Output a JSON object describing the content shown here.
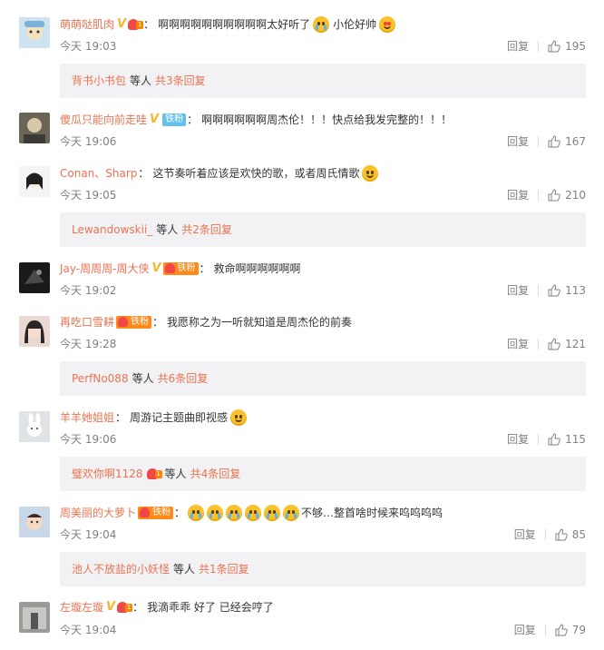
{
  "comments": [
    {
      "name": "萌萌哒肌肉",
      "verified": true,
      "fan_badge": "simple",
      "text": "啊啊啊啊啊啊啊啊啊啊太好听了",
      "tail": "小伦好帅",
      "emojis": [
        "cry-emoji",
        "love-emoji"
      ],
      "time": "今天 19:03",
      "reply_label": "回复",
      "likes": "195",
      "sub": {
        "name": "背书小书包",
        "mid": "等人",
        "count": "共3条回复"
      }
    },
    {
      "name": "傻瓜只能向前走哇",
      "verified": true,
      "fan_badge": "tiefen-blue",
      "fan_label": "铁粉",
      "text": "啊啊啊啊啊啊周杰伦！！！快点给我发完整的！！！",
      "tail": "",
      "emojis": [],
      "time": "今天 19:06",
      "reply_label": "回复",
      "likes": "167"
    },
    {
      "name": "Conan、Sharp",
      "verified": false,
      "fan_badge": "",
      "text": "这节奏听着应该是欢快的歌，或者周氏情歌",
      "tail": "",
      "emojis": [
        "smile-emoji"
      ],
      "time": "今天 19:05",
      "reply_label": "回复",
      "likes": "210",
      "sub": {
        "name": "Lewandowskii_",
        "mid": "等人",
        "count": "共2条回复"
      }
    },
    {
      "name": "Jay-周周周-周大侠",
      "verified": true,
      "fan_badge": "tiefen-orange",
      "fan_label": "铁粉",
      "text": "救命啊啊啊啊啊啊",
      "tail": "",
      "emojis": [],
      "time": "今天 19:02",
      "reply_label": "回复",
      "likes": "113"
    },
    {
      "name": "再吃口雪耕",
      "verified": false,
      "fan_badge": "tiefen-orange",
      "fan_label": "铁粉",
      "text": "我愿称之为一听就知道是周杰伦的前奏",
      "tail": "",
      "emojis": [],
      "time": "今天 19:28",
      "reply_label": "回复",
      "likes": "121",
      "sub": {
        "name": "PerfNo088",
        "mid": "等人",
        "count": "共6条回复"
      }
    },
    {
      "name": "羊羊她姐姐",
      "verified": false,
      "fan_badge": "",
      "text": "周游记主题曲即视感",
      "tail": "",
      "emojis": [
        "smile-emoji"
      ],
      "time": "今天 19:06",
      "reply_label": "回复",
      "likes": "115",
      "sub": {
        "name": "璧欢你啊1128",
        "mid": "等人",
        "count": "共4条回复",
        "badge": true
      }
    },
    {
      "name": "周美丽的大萝卜",
      "verified": false,
      "fan_badge": "tiefen-orange",
      "fan_label": "铁粉",
      "text": "不够…整首啥时候来呜呜呜呜",
      "tail": "",
      "emojis": [
        "cry-emoji",
        "cry-emoji",
        "cry-emoji",
        "cry-emoji",
        "cry-emoji",
        "cry-emoji"
      ],
      "emoji_first": true,
      "time": "今天 19:04",
      "reply_label": "回复",
      "likes": "85",
      "sub": {
        "name": "池人不放盐的小妖怪",
        "mid": "等人",
        "count": "共1条回复"
      }
    },
    {
      "name": "左璇左璇",
      "verified": true,
      "fan_badge": "simple",
      "text": "我滴乖乖 好了 已经会哼了",
      "tail": "",
      "emojis": [],
      "time": "今天 19:04",
      "reply_label": "回复",
      "likes": "79"
    }
  ],
  "colors": {
    "username": "#eb7350",
    "text": "#333333",
    "meta": "#808080",
    "subreply_bg": "#f2f2f5",
    "verified": "#f7b52a",
    "tiefen_blue": "#60c0ee",
    "tiefen_orange": "#ff8a1a"
  }
}
